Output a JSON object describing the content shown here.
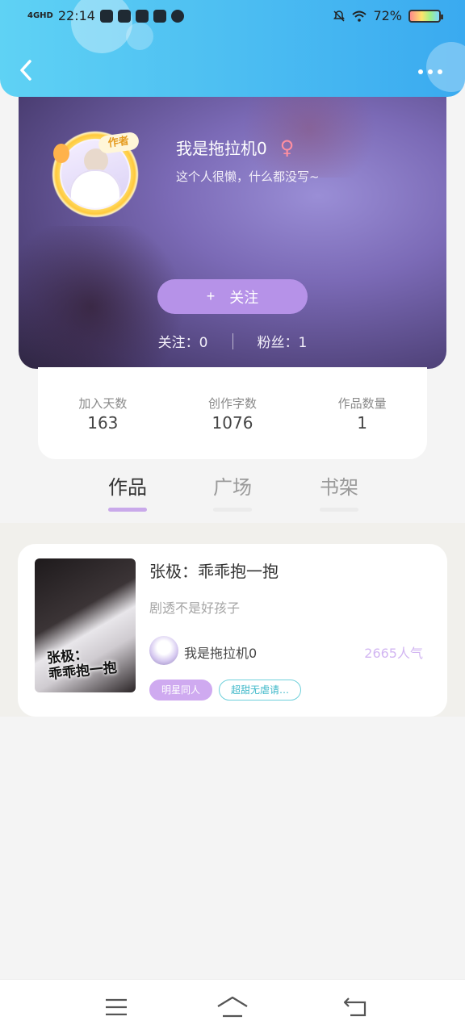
{
  "status_bar": {
    "network": "4GHD",
    "time": "22:14",
    "battery": "72%"
  },
  "header": {
    "back_icon": "chevron-left-icon",
    "more_icon": "more-dots-icon"
  },
  "profile": {
    "avatar_badge": "作者",
    "name": "我是拖拉机0",
    "gender_symbol": "♀",
    "bio": "这个人很懒，什么都没写~",
    "follow_button": {
      "plus": "+",
      "label": "关注"
    },
    "following_label": "关注：0",
    "fans_label": "粉丝：1"
  },
  "stats": [
    {
      "label": "加入天数",
      "value": "163"
    },
    {
      "label": "创作字数",
      "value": "1076"
    },
    {
      "label": "作品数量",
      "value": "1"
    }
  ],
  "tabs": [
    {
      "label": "作品",
      "active": true
    },
    {
      "label": "广场",
      "active": false
    },
    {
      "label": "书架",
      "active": false
    }
  ],
  "works": [
    {
      "cover_text": "张极：\n乖乖抱一抱",
      "title": "张极：乖乖抱一抱",
      "description": "剧透不是好孩子",
      "author": "我是拖拉机0",
      "popularity": "2665人气",
      "tags": [
        "明星同人",
        "超甜无虐请…"
      ]
    }
  ],
  "bottom_nav": {
    "menu_icon": "menu-icon",
    "home_icon": "home-icon",
    "back_icon": "back-icon"
  },
  "colors": {
    "header_gradient_start": "#5fd2f4",
    "header_gradient_end": "#3aaaf0",
    "accent_purple": "#b692e8",
    "tag_teal": "#3fb8c9"
  }
}
